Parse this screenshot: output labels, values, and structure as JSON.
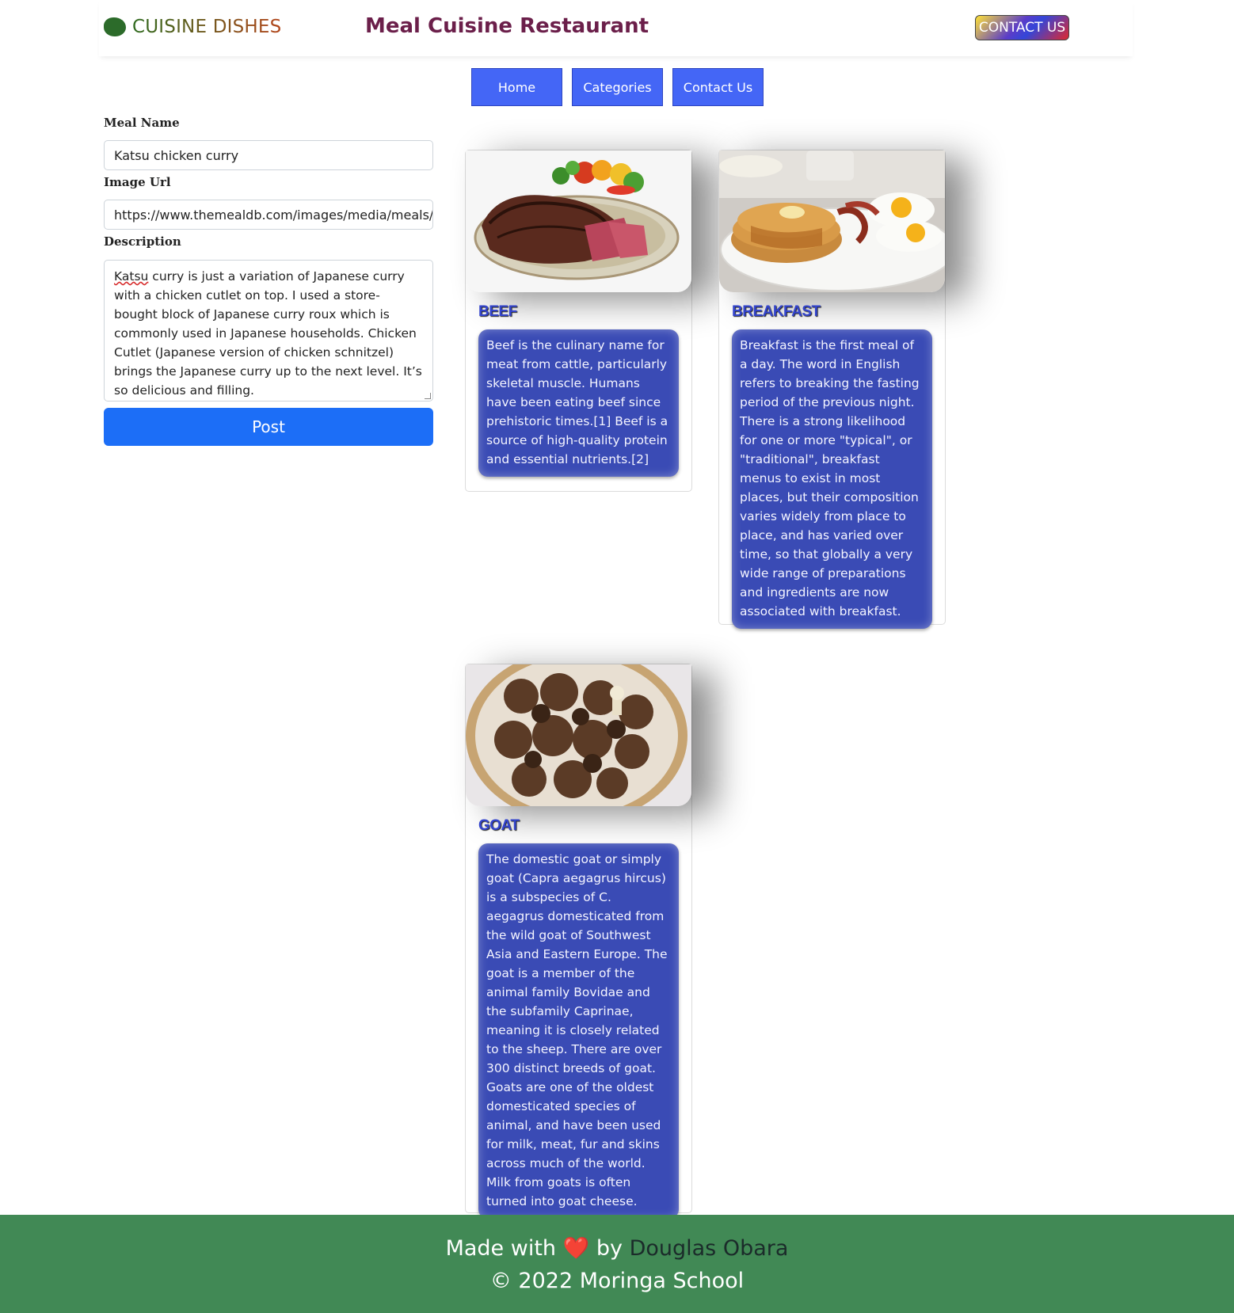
{
  "header": {
    "brand_icon": "leaf-icon",
    "brand": "CUISINE DISHES",
    "site_title": "Meal Cuisine Restaurant",
    "contact_button": "CONTACT US"
  },
  "nav": {
    "home": "Home",
    "categories": "Categories",
    "contact": "Contact Us"
  },
  "form": {
    "meal_name_label": "Meal Name",
    "meal_name_value": "Katsu chicken curry",
    "image_url_label": "Image Url",
    "image_url_value": "https://www.themealdb.com/images/media/meals/vw",
    "description_label": "Description",
    "description_first_word": "Katsu",
    "description_rest": " curry is just a variation of Japanese curry with a chicken cutlet on top. I used a store-bought block of Japanese curry roux which is commonly used in Japanese households. Chicken Cutlet (Japanese version of chicken schnitzel) brings the Japanese curry up to the next level. It’s so delicious and filling.",
    "post_button": "Post"
  },
  "categories": [
    {
      "title": "BEEF",
      "description": "Beef is the culinary name for meat from cattle, particularly skeletal muscle. Humans have been eating beef since prehistoric times.[1] Beef is a source of high-quality protein and essential nutrients.[2]"
    },
    {
      "title": "BREAKFAST",
      "description": "Breakfast is the first meal of a day. The word in English refers to breaking the fasting period of the previous night. There is a strong likelihood for one or more \"typical\", or \"traditional\", breakfast menus to exist in most places, but their composition varies widely from place to place, and has varied over time, so that globally a very wide range of preparations and ingredients are now associated with breakfast."
    },
    {
      "title": "GOAT",
      "description": "The domestic goat or simply goat (Capra aegagrus hircus) is a subspecies of C. aegagrus domesticated from the wild goat of Southwest Asia and Eastern Europe. The goat is a member of the animal family Bovidae and the subfamily Caprinae, meaning it is closely related to the sheep. There are over 300 distinct breeds of goat. Goats are one of the oldest domesticated species of animal, and have been used for milk, meat, fur and skins across much of the world. Milk from goats is often turned into goat cheese."
    }
  ],
  "footer": {
    "made_with": "Made with",
    "heart": "❤️",
    "by": "by",
    "author": "Douglas Obara",
    "copyright": "© 2022 Moringa School"
  },
  "colors": {
    "nav_button": "#4466f6",
    "post_button": "#1c6ef7",
    "card_description_bg": "#3a4bb5",
    "footer_bg": "#418955",
    "site_title": "#6b1f4a"
  }
}
